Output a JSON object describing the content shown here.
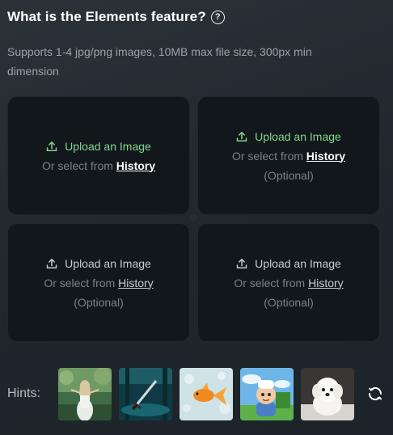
{
  "header": {
    "title": "What is the Elements feature?",
    "help_icon": "question-circle-icon"
  },
  "subtitle": "Supports 1-4 jpg/png images, 10MB max file size, 300px min dimension",
  "upload_cards": [
    {
      "upload_label": "Upload an Image",
      "select_prefix": "Or select from",
      "history_label": "History",
      "optional_label": "",
      "icon": "upload-icon",
      "accent": true
    },
    {
      "upload_label": "Upload an Image",
      "select_prefix": "Or select from",
      "history_label": "History",
      "optional_label": "(Optional)",
      "icon": "upload-icon",
      "accent": true
    },
    {
      "upload_label": "Upload an Image",
      "select_prefix": "Or select from",
      "history_label": "History",
      "optional_label": "(Optional)",
      "icon": "upload-icon",
      "accent": false
    },
    {
      "upload_label": "Upload an Image",
      "select_prefix": "Or select from",
      "history_label": "History",
      "optional_label": "(Optional)",
      "icon": "upload-icon",
      "accent": false
    }
  ],
  "hints": {
    "label": "Hints:",
    "thumbnails": [
      "forest-fairy-woman",
      "sword-in-water",
      "goldfish",
      "cartoon-boy-chef",
      "white-puppy"
    ],
    "refresh_icon": "refresh-icon"
  },
  "colors": {
    "accent_green": "#7fd88c",
    "card_background": "#12171b",
    "page_background": "#232b30"
  }
}
